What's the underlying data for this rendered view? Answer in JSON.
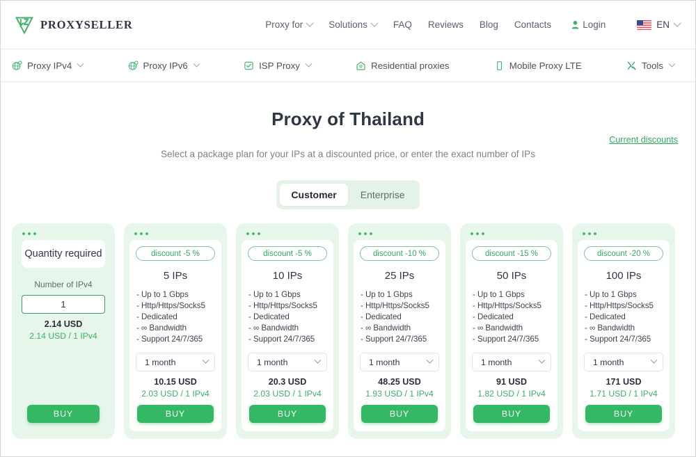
{
  "brand": {
    "name": "PROXYSELLER",
    "logo_icon": "proxyseller-logo-icon",
    "accent_color": "#34b864",
    "dark_color": "#2f3646"
  },
  "topnav": {
    "items": [
      {
        "label": "Proxy for",
        "has_caret": true
      },
      {
        "label": "Solutions",
        "has_caret": true
      },
      {
        "label": "FAQ",
        "has_caret": false
      },
      {
        "label": "Reviews",
        "has_caret": false
      },
      {
        "label": "Blog",
        "has_caret": false
      },
      {
        "label": "Contacts",
        "has_caret": false
      }
    ],
    "login_label": "Login",
    "login_icon": "person-icon",
    "language": {
      "label": "EN",
      "flag_icon": "flag-us-icon",
      "has_caret": true
    }
  },
  "subnav": {
    "items": [
      {
        "label": "Proxy IPv4",
        "icon": "globe-icon",
        "has_caret": true
      },
      {
        "label": "Proxy IPv6",
        "icon": "globe-icon",
        "has_caret": true
      },
      {
        "label": "ISP Proxy",
        "icon": "server-check-icon",
        "has_caret": true
      },
      {
        "label": "Residential proxies",
        "icon": "home-icon",
        "has_caret": false
      },
      {
        "label": "Mobile Proxy LTE",
        "icon": "mobile-icon",
        "has_caret": false
      },
      {
        "label": "Tools",
        "icon": "tools-icon",
        "has_caret": true
      }
    ]
  },
  "hero": {
    "title": "Proxy of Thailand",
    "subtitle": "Select a package plan for your IPs at a discounted price, or enter the exact number of IPs",
    "discount_link": "Current discounts"
  },
  "segmented": {
    "options": [
      "Customer",
      "Enterprise"
    ],
    "active": "Customer"
  },
  "cards": [
    {
      "type": "quantity",
      "title": "Quantity required",
      "field_label": "Number of IPv4",
      "field_value": "1",
      "field_placeholder": "1",
      "price": "2.14 USD",
      "price_unit": "2.14 USD / 1 IPv4",
      "buy_label": "BUY"
    },
    {
      "type": "package",
      "badge": "discount -5 %",
      "title": "5 IPs",
      "features": [
        "- Up to 1 Gbps",
        "- Http/Https/Socks5",
        "- Dedicated",
        "- ∞ Bandwidth",
        "- Support 24/7/365"
      ],
      "period": "1 month",
      "price": "10.15 USD",
      "price_unit": "2.03 USD / 1 IPv4",
      "buy_label": "BUY"
    },
    {
      "type": "package",
      "badge": "discount -5 %",
      "title": "10 IPs",
      "features": [
        "- Up to 1 Gbps",
        "- Http/Https/Socks5",
        "- Dedicated",
        "- ∞ Bandwidth",
        "- Support 24/7/365"
      ],
      "period": "1 month",
      "price": "20.3 USD",
      "price_unit": "2.03 USD / 1 IPv4",
      "buy_label": "BUY"
    },
    {
      "type": "package",
      "badge": "discount -10 %",
      "title": "25 IPs",
      "features": [
        "- Up to 1 Gbps",
        "- Http/Https/Socks5",
        "- Dedicated",
        "- ∞ Bandwidth",
        "- Support 24/7/365"
      ],
      "period": "1 month",
      "price": "48.25 USD",
      "price_unit": "1.93 USD / 1 IPv4",
      "buy_label": "BUY"
    },
    {
      "type": "package",
      "badge": "discount -15 %",
      "title": "50 IPs",
      "features": [
        "- Up to 1 Gbps",
        "- Http/Https/Socks5",
        "- Dedicated",
        "- ∞ Bandwidth",
        "- Support 24/7/365"
      ],
      "period": "1 month",
      "price": "91 USD",
      "price_unit": "1.82 USD / 1 IPv4",
      "buy_label": "BUY"
    },
    {
      "type": "package",
      "badge": "discount -20 %",
      "title": "100 IPs",
      "features": [
        "- Up to 1 Gbps",
        "- Http/Https/Socks5",
        "- Dedicated",
        "- ∞ Bandwidth",
        "- Support 24/7/365"
      ],
      "period": "1 month",
      "price": "171 USD",
      "price_unit": "1.71 USD / 1 IPv4",
      "buy_label": "BUY"
    }
  ]
}
